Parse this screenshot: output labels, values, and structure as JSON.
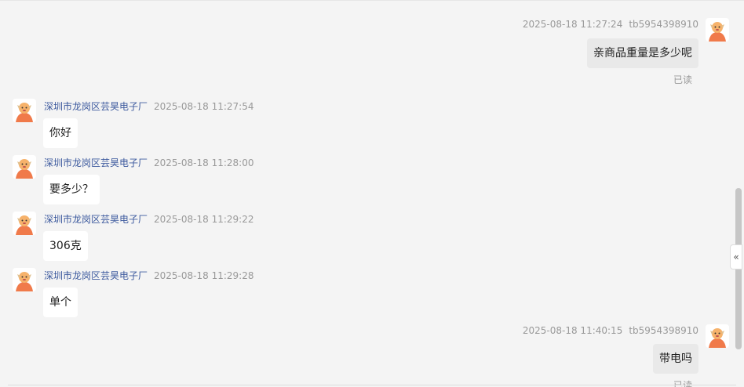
{
  "messages": [
    {
      "side": "right",
      "time": "2025-08-18 11:27:24",
      "nick": "tb5954398910",
      "text": "亲商品重量是多少呢",
      "status": "已读"
    },
    {
      "side": "left",
      "shop": "深圳市龙岗区芸昊电子厂",
      "time": "2025-08-18 11:27:54",
      "text": "你好"
    },
    {
      "side": "left",
      "shop": "深圳市龙岗区芸昊电子厂",
      "time": "2025-08-18 11:28:00",
      "text": "要多少？"
    },
    {
      "side": "left",
      "shop": "深圳市龙岗区芸昊电子厂",
      "time": "2025-08-18 11:29:22",
      "text": "306克"
    },
    {
      "side": "left",
      "shop": "深圳市龙岗区芸昊电子厂",
      "time": "2025-08-18 11:29:28",
      "text": "单个"
    },
    {
      "side": "right",
      "time": "2025-08-18 11:40:15",
      "nick": "tb5954398910",
      "text": "带电吗",
      "status": "已读"
    }
  ],
  "collapse_icon": "double-chevron-left-icon",
  "collapse_glyph": "«"
}
